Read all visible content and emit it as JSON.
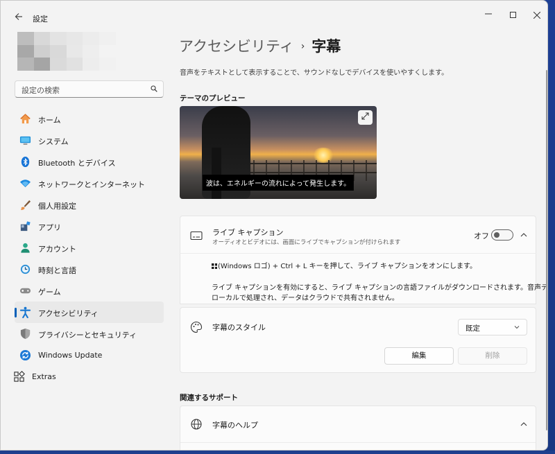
{
  "window": {
    "title": "設定"
  },
  "avatar_colors": [
    "#bdbdbd",
    "#d8d8d8",
    "#e3e3e3",
    "#e7e7e7",
    "#ececec",
    "#f0f0f0",
    "#a8a8a8",
    "#cfcfcf",
    "#d9d9d9",
    "#e8e8e8",
    "#eeeeee",
    "#f3f3f3",
    "#b6b6b6",
    "#a5a5a5",
    "#dadada",
    "#e1e1e1",
    "#ededed",
    "#f1f1f1"
  ],
  "search": {
    "placeholder": "設定の検索"
  },
  "nav": {
    "items": [
      {
        "label": "ホーム",
        "icon": "home-icon"
      },
      {
        "label": "システム",
        "icon": "system-icon"
      },
      {
        "label": "Bluetooth とデバイス",
        "icon": "bluetooth-icon"
      },
      {
        "label": "ネットワークとインターネット",
        "icon": "network-icon"
      },
      {
        "label": "個人用設定",
        "icon": "personalization-icon"
      },
      {
        "label": "アプリ",
        "icon": "apps-icon"
      },
      {
        "label": "アカウント",
        "icon": "account-icon"
      },
      {
        "label": "時刻と言語",
        "icon": "time-language-icon"
      },
      {
        "label": "ゲーム",
        "icon": "gaming-icon"
      },
      {
        "label": "アクセシビリティ",
        "icon": "accessibility-icon",
        "active": true
      },
      {
        "label": "プライバシーとセキュリティ",
        "icon": "shield-icon"
      },
      {
        "label": "Windows Update",
        "icon": "windows-update-icon"
      }
    ],
    "extras": {
      "label": "Extras",
      "icon": "extras-icon"
    }
  },
  "breadcrumb": {
    "parent": "アクセシビリティ",
    "separator": "›",
    "current": "字幕"
  },
  "description": "音声をテキストとして表示することで、サウンドなしでデバイスを使いやすくします。",
  "preview": {
    "heading": "テーマのプレビュー",
    "caption": "波は、エネルギーの流れによって発生します。"
  },
  "live_caption": {
    "title": "ライブ キャプション",
    "subtitle": "オーディオとビデオには、画面にライブでキャプションが付けられます",
    "toggle_label": "オフ",
    "toggle_on": false,
    "shortcut_pre": "(Windows ロゴ) + Ctrl + L キーを押して、ライブ キャプションをオンにします。",
    "info_line1": "ライブ キャプションを有効にすると、ライブ キャプションの言語ファイルがダウンロードされます。音声データは",
    "info_line2": "ローカルで処理され、データはクラウドで共有されません。"
  },
  "caption_style": {
    "title": "字幕のスタイル",
    "selected": "既定",
    "edit_label": "編集",
    "delete_label": "削除"
  },
  "related": {
    "heading": "関連するサポート",
    "help_title": "字幕のヘルプ"
  },
  "colors": {
    "accent": "#005fb8"
  }
}
